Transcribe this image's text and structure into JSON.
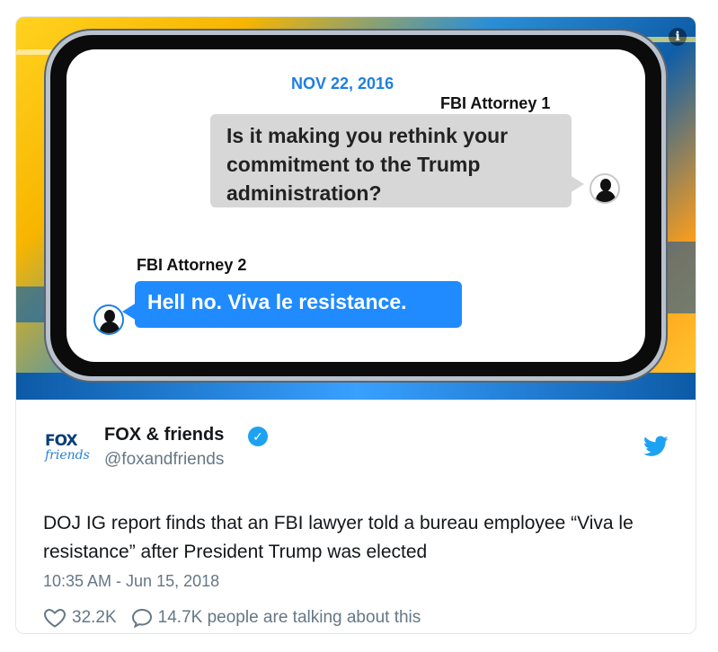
{
  "media": {
    "date": "NOV 22, 2016",
    "attorney1_label": "FBI Attorney 1",
    "message1": "Is it making you rethink your commitment to the Trump administration?",
    "attorney2_label": "FBI Attorney 2",
    "message2": "Hell no. Viva le resistance.",
    "info_icon": "i"
  },
  "author": {
    "logo_top": "FOX",
    "logo_bottom": "friends",
    "name": "FOX & friends",
    "handle": "@foxandfriends",
    "verified_icon": "✓"
  },
  "tweet": {
    "text": "DOJ IG report finds that an FBI lawyer told a bureau employee “Viva le resistance” after President Trump was elected",
    "timestamp": "10:35 AM - Jun 15, 2018",
    "likes": "32.2K",
    "talking": "14.7K people are talking about this"
  },
  "colors": {
    "accent": "#1da1f2",
    "bubble_blue": "#1f8bff",
    "date_blue": "#1e7fe0"
  }
}
